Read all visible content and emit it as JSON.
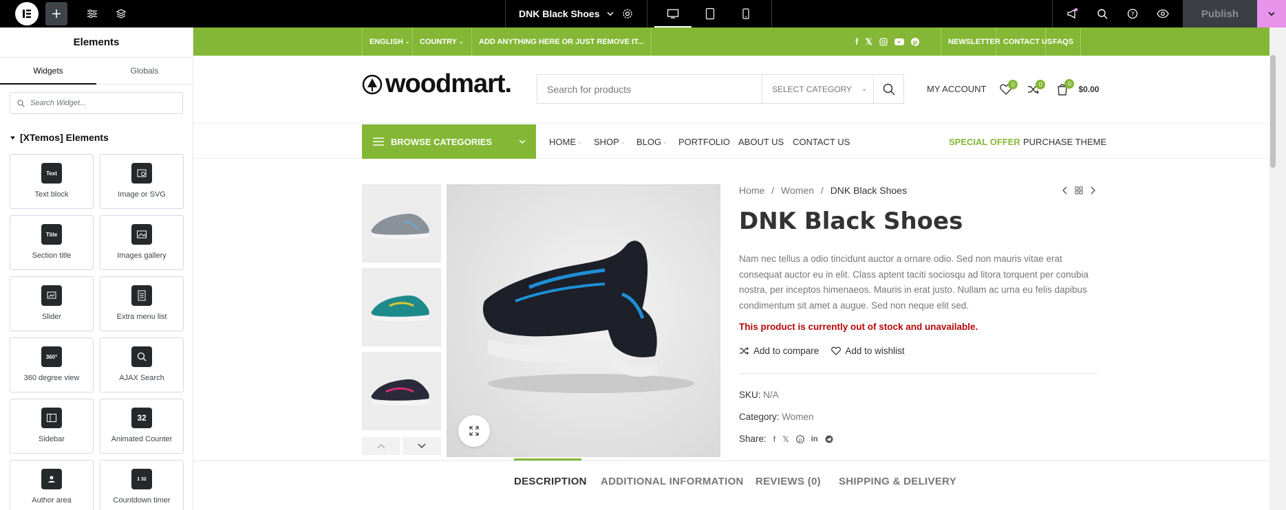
{
  "editor": {
    "doc_title": "DNK Black Shoes",
    "publish_label": "Publish"
  },
  "panel": {
    "title": "Elements",
    "tabs": [
      "Widgets",
      "Globals"
    ],
    "search_placeholder": "Search Widget...",
    "category": "[XTemos] Elements",
    "widgets": [
      {
        "label": "Text block",
        "icon": "text-block-icon",
        "glyph": "Text"
      },
      {
        "label": "Image or SVG",
        "icon": "image-svg-icon",
        "glyph": ""
      },
      {
        "label": "Section title",
        "icon": "section-title-icon",
        "glyph": "Title"
      },
      {
        "label": "Images gallery",
        "icon": "images-gallery-icon",
        "glyph": ""
      },
      {
        "label": "Slider",
        "icon": "slider-icon",
        "glyph": ""
      },
      {
        "label": "Extra menu list",
        "icon": "extra-menu-list-icon",
        "glyph": ""
      },
      {
        "label": "360 degree view",
        "icon": "360-view-icon",
        "glyph": "360°"
      },
      {
        "label": "AJAX Search",
        "icon": "ajax-search-icon",
        "glyph": ""
      },
      {
        "label": "Sidebar",
        "icon": "sidebar-icon",
        "glyph": ""
      },
      {
        "label": "Animated Counter",
        "icon": "animated-counter-icon",
        "glyph": "32"
      },
      {
        "label": "Author area",
        "icon": "author-area-icon",
        "glyph": ""
      },
      {
        "label": "Countdown timer",
        "icon": "countdown-timer-icon",
        "glyph": "1 32"
      }
    ]
  },
  "topbar": {
    "items": [
      "ENGLISH",
      "COUNTRY",
      "ADD ANYTHING HERE OR JUST REMOVE IT..."
    ],
    "links": [
      "NEWSLETTER",
      "CONTACT US",
      "FAQS"
    ]
  },
  "header": {
    "logo": "woodmart.",
    "search_placeholder": "Search for products",
    "category_select": "SELECT CATEGORY",
    "account": "MY ACCOUNT",
    "wishlist_count": "0",
    "compare_count": "0",
    "cart_count": "0",
    "cart_total": "$0.00"
  },
  "nav": {
    "browse": "BROWSE CATEGORIES",
    "items": [
      "HOME",
      "SHOP",
      "BLOG",
      "PORTFOLIO",
      "ABOUT US",
      "CONTACT US"
    ],
    "special": "SPECIAL OFFER",
    "purchase": "PURCHASE THEME"
  },
  "product": {
    "breadcrumb": [
      "Home",
      "Women",
      "DNK Black Shoes"
    ],
    "title": "DNK Black Shoes",
    "description": "Nam nec tellus a odio tincidunt auctor a ornare odio. Sed non mauris vitae erat consequat auctor eu in elit. Class aptent taciti sociosqu ad litora torquent per conubia nostra, per inceptos himenaeos. Mauris in erat justo. Nullam ac urna eu felis dapibus condimentum sit amet a augue. Sed non neque elit sed.",
    "stock": "This product is currently out of stock and unavailable.",
    "compare": "Add to compare",
    "wishlist": "Add to wishlist",
    "sku_label": "SKU:",
    "sku": "N/A",
    "category_label": "Category:",
    "category": "Women",
    "share_label": "Share:",
    "tabs": [
      "DESCRIPTION",
      "ADDITIONAL INFORMATION",
      "REVIEWS (0)",
      "SHIPPING & DELIVERY"
    ]
  },
  "colors": {
    "accent": "#83b735",
    "stock_warning": "#b50808",
    "publish_dropdown": "#e893ea"
  }
}
